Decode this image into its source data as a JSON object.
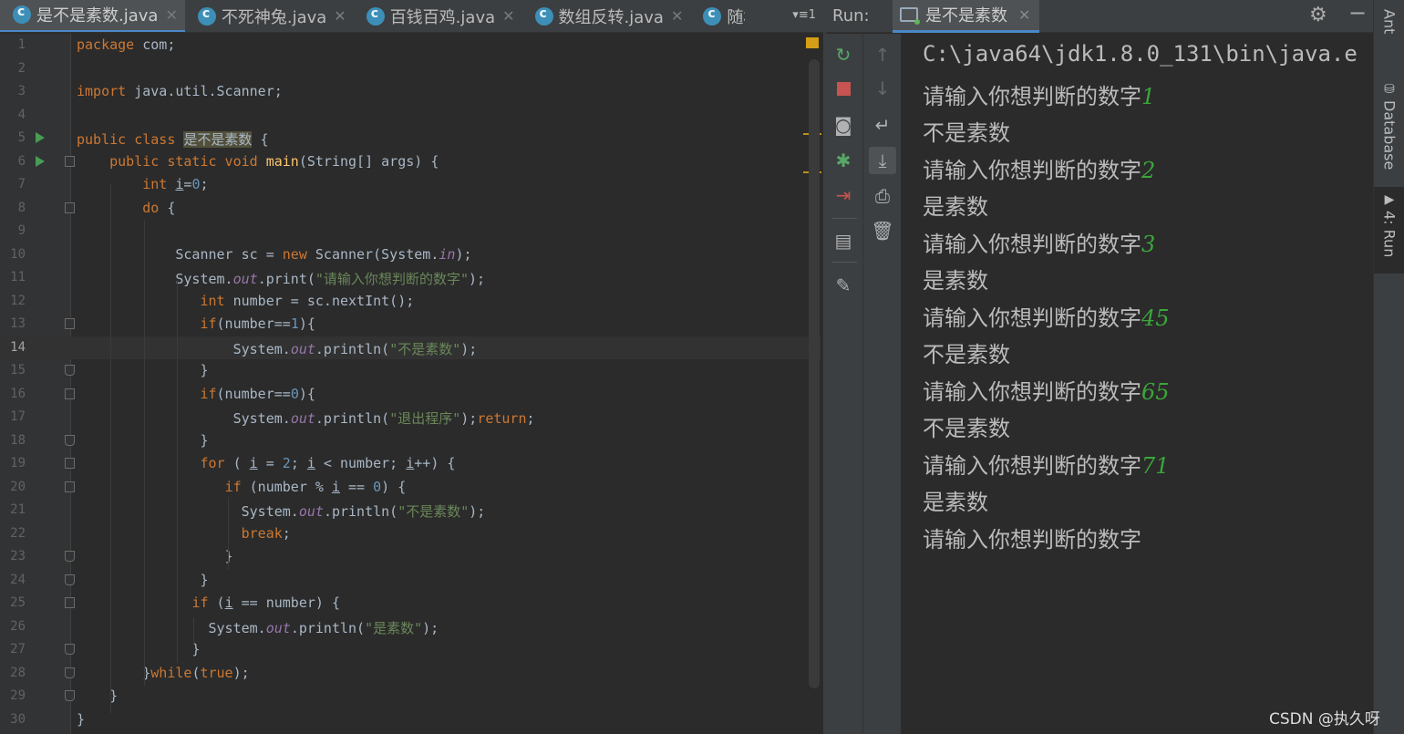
{
  "editor_tabs": [
    {
      "label": "是不是素数.java",
      "active": true
    },
    {
      "label": "不死神兔.java",
      "active": false
    },
    {
      "label": "百钱百鸡.java",
      "active": false
    },
    {
      "label": "数组反转.java",
      "active": false
    },
    {
      "label": "随机",
      "active": false
    }
  ],
  "tab_overflow": "▾≡1",
  "code_lines": [
    {
      "n": "1",
      "html": "<span class='kw'>package</span> com;"
    },
    {
      "n": "2",
      "html": ""
    },
    {
      "n": "3",
      "html": "<span class='kw'>import</span> java.util.Scanner;"
    },
    {
      "n": "4",
      "html": ""
    },
    {
      "n": "5",
      "html": "<span class='kw'>public class</span> <span class='hl'>是不是素数</span> {"
    },
    {
      "n": "6",
      "html": "    <span class='kw'>public static void</span> <span class='fn'>main</span>(String[] args) {"
    },
    {
      "n": "7",
      "html": "        <span class='kw'>int</span> <span class='ul'>i</span>=<span class='num'>0</span>;"
    },
    {
      "n": "8",
      "html": "        <span class='kw'>do</span> {"
    },
    {
      "n": "9",
      "html": ""
    },
    {
      "n": "10",
      "html": "            Scanner sc = <span class='kw'>new</span> Scanner(System.<span class='st'>in</span>);"
    },
    {
      "n": "11",
      "html": "            System.<span class='st'>out</span>.print(<span class='str'>\"请输入你想判断的数字\"</span>);"
    },
    {
      "n": "12",
      "html": "               <span class='kw'>int</span> number = sc.nextInt();"
    },
    {
      "n": "13",
      "html": "               <span class='kw'>if</span>(number==<span class='num'>1</span>){"
    },
    {
      "n": "14",
      "html": "                   System.<span class='st'>out</span>.println(<span class='str'>\"不是素数\"</span>);"
    },
    {
      "n": "15",
      "html": "               }"
    },
    {
      "n": "16",
      "html": "               <span class='kw'>if</span>(number==<span class='num'>0</span>){"
    },
    {
      "n": "17",
      "html": "                   System.<span class='st'>out</span>.println(<span class='str'>\"退出程序\"</span>);<span class='kw'>return</span>;"
    },
    {
      "n": "18",
      "html": "               }"
    },
    {
      "n": "19",
      "html": "               <span class='kw'>for</span> ( <span class='ul'>i</span> = <span class='num'>2</span>; <span class='ul'>i</span> &lt; number; <span class='ul'>i</span>++) {"
    },
    {
      "n": "20",
      "html": "                  <span class='kw'>if</span> (number % <span class='ul'>i</span> == <span class='num'>0</span>) {"
    },
    {
      "n": "21",
      "html": "                    System.<span class='st'>out</span>.println(<span class='str'>\"不是素数\"</span>);"
    },
    {
      "n": "22",
      "html": "                    <span class='kw'>break</span>;"
    },
    {
      "n": "23",
      "html": "                  }"
    },
    {
      "n": "24",
      "html": "               }"
    },
    {
      "n": "25",
      "html": "              <span class='kw'>if</span> (<span class='ul'>i</span> == number) {"
    },
    {
      "n": "26",
      "html": "                System.<span class='st'>out</span>.println(<span class='str'>\"是素数\"</span>);"
    },
    {
      "n": "27",
      "html": "              }"
    },
    {
      "n": "28",
      "html": "        }<span class='kw'>while</span>(<span class='kw'>true</span>);"
    },
    {
      "n": "29",
      "html": "    }"
    },
    {
      "n": "30",
      "html": "}"
    }
  ],
  "run": {
    "label": "Run:",
    "tab_label": "是不是素数",
    "console": [
      {
        "text": "C:\\java64\\jdk1.8.0_131\\bin\\java.e",
        "input": ""
      },
      {
        "text": "请输入你想判断的数字",
        "input": "1"
      },
      {
        "text": "不是素数",
        "input": ""
      },
      {
        "text": "请输入你想判断的数字",
        "input": "2"
      },
      {
        "text": "是素数",
        "input": ""
      },
      {
        "text": "请输入你想判断的数字",
        "input": "3"
      },
      {
        "text": "是素数",
        "input": ""
      },
      {
        "text": "请输入你想判断的数字",
        "input": "45"
      },
      {
        "text": "不是素数",
        "input": ""
      },
      {
        "text": "请输入你想判断的数字",
        "input": "65"
      },
      {
        "text": "不是素数",
        "input": ""
      },
      {
        "text": "请输入你想判断的数字",
        "input": "71"
      },
      {
        "text": "是素数",
        "input": ""
      },
      {
        "text": "请输入你想判断的数字",
        "input": ""
      }
    ]
  },
  "right_tabs": [
    "Ant",
    "Database",
    "4: Run"
  ],
  "watermark": "CSDN @执久呀",
  "icons": {
    "rerun": "rerun-icon",
    "stop": "stop-icon",
    "camera": "dump-threads-icon",
    "bug": "debug-icon",
    "exit": "exit-icon",
    "layout": "layout-icon",
    "pin": "pin-icon",
    "up": "arrow-up-icon",
    "down": "arrow-down-icon",
    "wrap": "soft-wrap-icon",
    "scroll": "scroll-to-end-icon",
    "print": "print-icon",
    "trash": "clear-icon"
  },
  "colors": {
    "keyword": "#cc7832",
    "string": "#6a8759",
    "number": "#6897bb",
    "input": "#3ba63b",
    "accent": "#4a88c7"
  }
}
